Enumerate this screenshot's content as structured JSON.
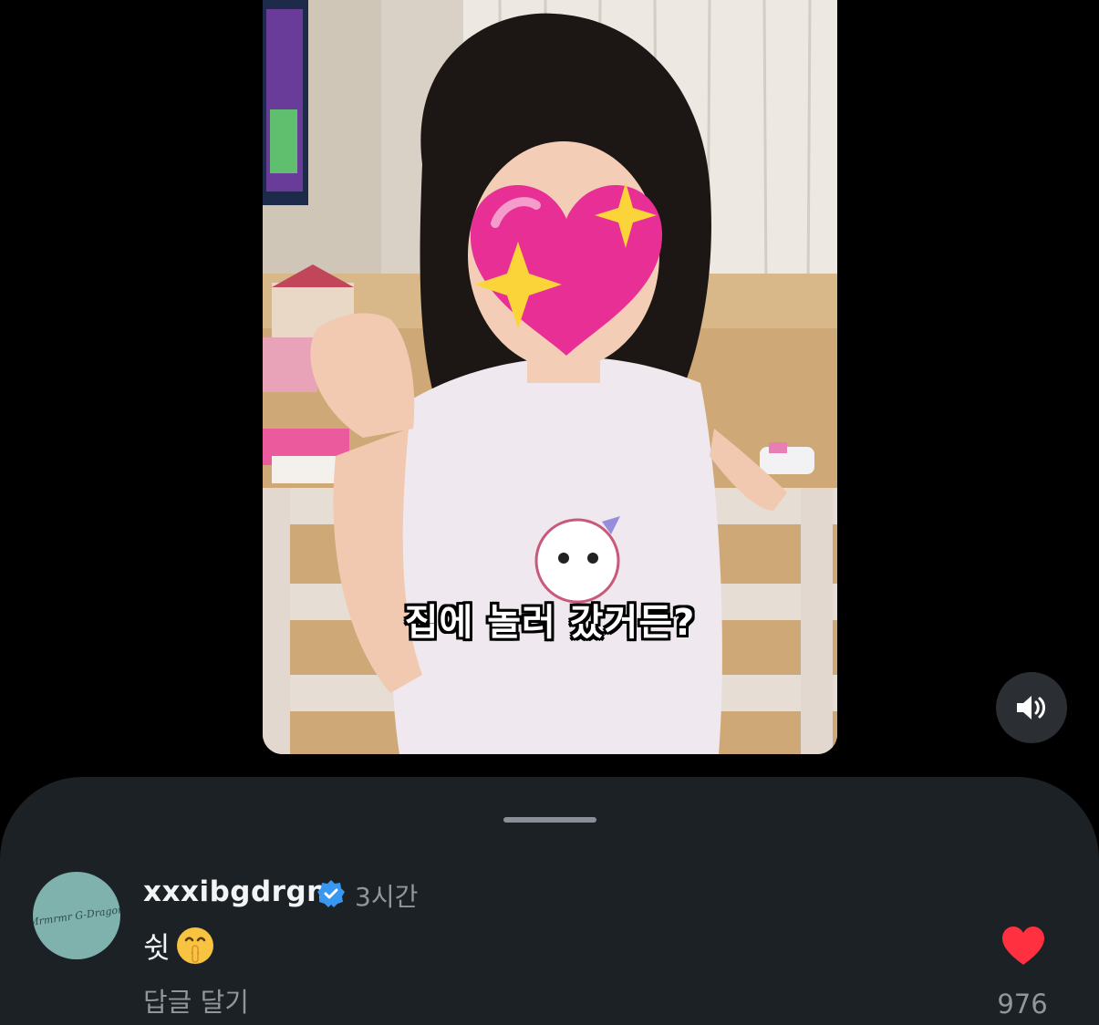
{
  "video": {
    "caption": "집에 놀러 갔거든?",
    "sound_icon": "speaker-volume-icon"
  },
  "comment": {
    "avatar_text": "Mrmrmr G-Dragon",
    "username": "xxxibgdrgn",
    "verified_icon": "verified-badge-icon",
    "time_ago": "3시간",
    "text": "쉿",
    "emoji": "🤫",
    "reply_label": "답글 달기",
    "like_icon": "heart-icon",
    "like_count": "976"
  },
  "colors": {
    "background": "#000000",
    "sheet": "#1b2125",
    "verified_blue": "#3897f0",
    "like_red": "#ff3040",
    "muted_text": "#8f969c"
  }
}
